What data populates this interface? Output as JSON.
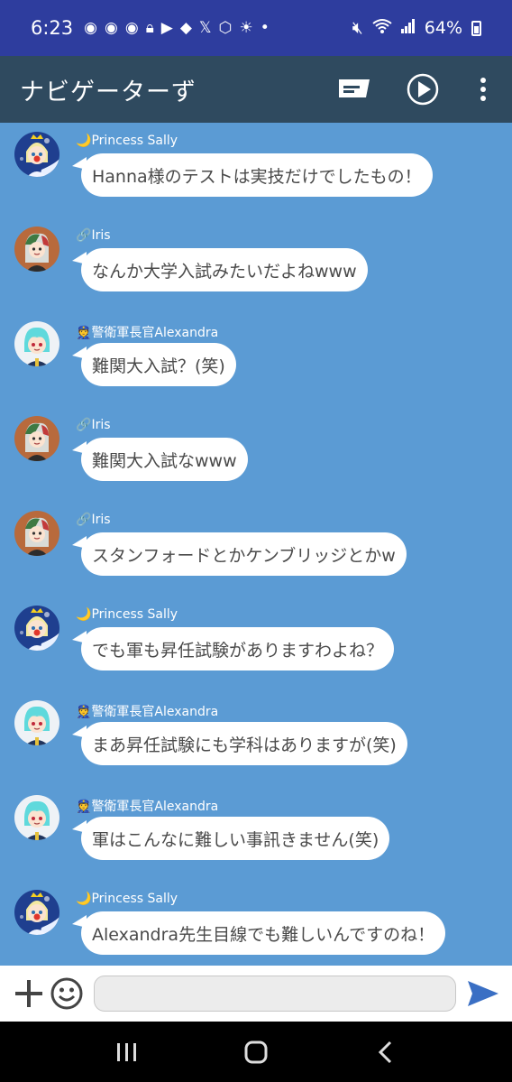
{
  "status_bar": {
    "time": "6:23",
    "battery": "64%"
  },
  "header": {
    "title": "ナビゲーターず",
    "icons": [
      "message-icon",
      "play-icon",
      "more-vertical-icon"
    ]
  },
  "messages": [
    {
      "sender": "Princess Sally",
      "badge": "🌙",
      "text": "Hanna様のテストは実技だけでしたもの！",
      "avatar": "sally"
    },
    {
      "sender": "Iris",
      "badge": "🔗",
      "text": "なんか大学入試みたいだよねwww",
      "avatar": "iris"
    },
    {
      "sender": "警衛軍長官Alexandra",
      "badge": "👮",
      "text": "難関大入試？(笑)",
      "avatar": "alexandra"
    },
    {
      "sender": "Iris",
      "badge": "🔗",
      "text": "難関大入試なwww",
      "avatar": "iris"
    },
    {
      "sender": "Iris",
      "badge": "🔗",
      "text": "スタンフォードとかケンブリッジとかw",
      "avatar": "iris"
    },
    {
      "sender": "Princess Sally",
      "badge": "🌙",
      "text": "でも軍も昇任試験がありますわよね？",
      "avatar": "sally"
    },
    {
      "sender": "警衛軍長官Alexandra",
      "badge": "👮",
      "text": "まあ昇任試験にも学科はありますが(笑)",
      "avatar": "alexandra"
    },
    {
      "sender": "警衛軍長官Alexandra",
      "badge": "👮",
      "text": "軍はこんなに難しい事訊きません(笑)",
      "avatar": "alexandra"
    },
    {
      "sender": "Princess Sally",
      "badge": "🌙",
      "text": "Alexandra先生目線でも難しいんですのね！",
      "avatar": "sally"
    }
  ],
  "input": {
    "value": "",
    "icons": [
      "plus-icon",
      "emoji-icon",
      "send-icon"
    ]
  },
  "colors": {
    "status_bar": "#2e3d9e",
    "header": "#2f4a5f",
    "chat_bg": "#5b9bd4",
    "send": "#3a6fc4"
  }
}
